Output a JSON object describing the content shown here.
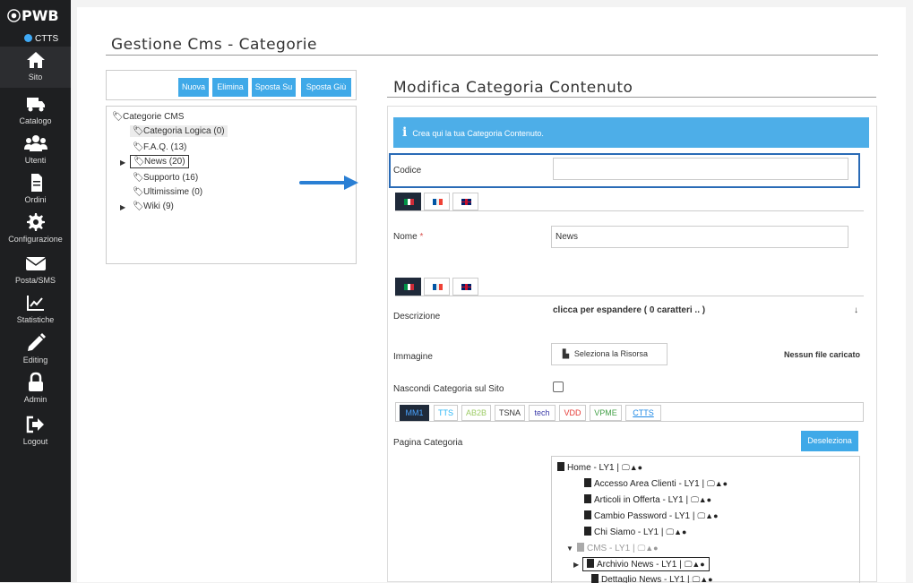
{
  "app": {
    "logo": "PWB",
    "badge": "CTTS"
  },
  "nav": [
    {
      "label": "Sito",
      "icon": "home-icon"
    },
    {
      "label": "Catalogo",
      "icon": "truck-icon"
    },
    {
      "label": "Utenti",
      "icon": "users-icon"
    },
    {
      "label": "Ordini",
      "icon": "document-icon"
    },
    {
      "label": "Configurazione",
      "icon": "gear-icon"
    },
    {
      "label": "Posta/SMS",
      "icon": "envelope-icon"
    },
    {
      "label": "Statistiche",
      "icon": "chart-icon"
    },
    {
      "label": "Editing",
      "icon": "pencil-icon"
    },
    {
      "label": "Admin",
      "icon": "lock-icon"
    },
    {
      "label": "Logout",
      "icon": "logout-icon"
    }
  ],
  "page": {
    "title": "Gestione Cms - Categorie"
  },
  "toolbar": {
    "new": "Nuova",
    "delete": "Elimina",
    "move_up": "Sposta Su",
    "move_down": "Sposta Giù"
  },
  "tree": {
    "root": "Categorie CMS",
    "items": [
      "Categoria Logica (0)",
      "F.A.Q. (13)",
      "News (20)",
      "Supporto (16)",
      "Ultimissime (0)",
      "Wiki (9)"
    ]
  },
  "form": {
    "title": "Modifica Categoria Contenuto",
    "info": "Crea qui la tua Categoria Contenuto.",
    "code_label": "Codice",
    "code_value": "",
    "name_label": "Nome",
    "name_required": "*",
    "name_value": "News",
    "desc_label": "Descrizione",
    "desc_expand": "clicca per espandere ( 0 caratteri .. )",
    "desc_arrow": "↓",
    "image_label": "Immagine",
    "image_button": "Seleziona la Risorsa",
    "image_status": "Nessun file caricato",
    "hide_label": "Nascondi Categoria sul Sito",
    "page_label": "Pagina Categoria",
    "deselect_button": "Deseleziona"
  },
  "site_tabs": [
    {
      "label": "MM1",
      "color": "#4aa3ff"
    },
    {
      "label": "TTS",
      "color": "#29b6f6"
    },
    {
      "label": "AB2B",
      "color": "#9ccc65"
    },
    {
      "label": "TSNA",
      "color": "#333333"
    },
    {
      "label": "tech",
      "color": "#3a3aa8"
    },
    {
      "label": "VDD",
      "color": "#e53935"
    },
    {
      "label": "VPME",
      "color": "#43a047"
    },
    {
      "label": "CTTS",
      "color": "#1e88e5"
    }
  ],
  "pages": [
    {
      "label": "Home - LY1",
      "devices": "|",
      "muted": false
    },
    {
      "label": "Accesso Area Clienti - LY1",
      "devices": "|",
      "muted": false
    },
    {
      "label": "Articoli in Offerta - LY1",
      "devices": "|",
      "muted": false
    },
    {
      "label": "Cambio Password - LY1",
      "devices": "|",
      "muted": false
    },
    {
      "label": "Chi Siamo - LY1",
      "devices": "|",
      "muted": false
    },
    {
      "label": "CMS - LY1",
      "devices": "|",
      "muted": true
    },
    {
      "label": "Archivio News - LY1",
      "devices": "|",
      "muted": false
    },
    {
      "label": "Dettaglio News - LY1",
      "devices": "|",
      "muted": false
    }
  ]
}
